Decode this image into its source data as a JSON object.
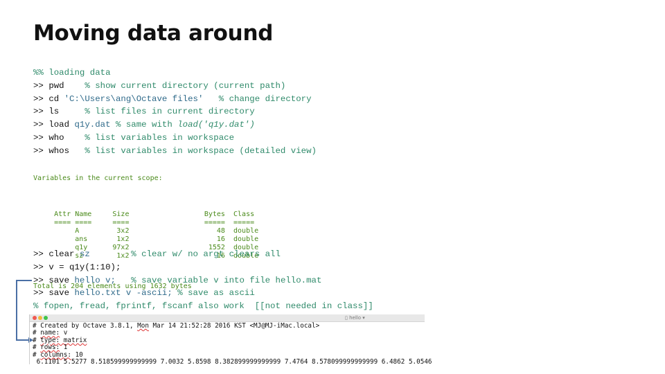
{
  "title": "Moving data around",
  "code_block_1": [
    {
      "prompt": "%%",
      "cmd": "",
      "arg": "",
      "comment": " loading data",
      "prompt_is_comment": true
    },
    {
      "prompt": ">> ",
      "cmd": "pwd",
      "arg": "",
      "comment": "    % show current directory (current path)"
    },
    {
      "prompt": ">> ",
      "cmd": "cd ",
      "arg": "'C:\\Users\\ang\\Octave files'",
      "comment": "   % change directory"
    },
    {
      "prompt": ">> ",
      "cmd": "ls",
      "arg": "",
      "comment": "     % list files in current directory"
    },
    {
      "prompt": ">> ",
      "cmd": "load ",
      "arg": "q1y.dat",
      "comment": " % same with ",
      "italic": "load('q1y.dat')"
    },
    {
      "prompt": ">> ",
      "cmd": "who",
      "arg": "",
      "comment": "    % list variables in workspace"
    },
    {
      "prompt": ">> ",
      "cmd": "whos",
      "arg": "",
      "comment": "   % list variables in workspace (detailed view)"
    }
  ],
  "whos_output": {
    "scope_label": "Variables in the current scope:",
    "headers": {
      "attr": "Attr",
      "name": "Name",
      "size": "Size",
      "bytes": "Bytes",
      "class": "Class"
    },
    "underline": {
      "attr": "====",
      "name": "====",
      "size": "====",
      "bytes": "=====",
      "class": "====="
    },
    "rows": [
      {
        "attr": "",
        "name": "A",
        "size": "3x2",
        "bytes": "48",
        "class": "double"
      },
      {
        "attr": "",
        "name": "ans",
        "size": "1x2",
        "bytes": "16",
        "class": "double"
      },
      {
        "attr": "",
        "name": "q1y",
        "size": "97x2",
        "bytes": "1552",
        "class": "double"
      },
      {
        "attr": "",
        "name": "sz",
        "size": "1x2",
        "bytes": "16",
        "class": "double"
      }
    ],
    "total": "Total is 204 elements using 1632 bytes"
  },
  "code_block_2": [
    {
      "prompt": ">> ",
      "cmd": "clear ",
      "arg": "sz",
      "comment": "        % clear w/ no argt clears all"
    },
    {
      "prompt": ">> ",
      "cmd": "v = q1y(1:10);",
      "arg": "",
      "comment": ""
    },
    {
      "prompt": ">> ",
      "cmd": "save ",
      "arg": "hello v;",
      "comment": "   % save variable v into file hello.mat"
    },
    {
      "prompt": ">> ",
      "cmd": "save ",
      "arg": "hello.txt v -ascii;",
      "comment": " % save as ascii"
    },
    {
      "prompt": "",
      "cmd": "",
      "arg": "",
      "comment": "% fopen, fread, fprintf, fscanf also work  [[not needed in class]]"
    }
  ],
  "editor": {
    "filename": "hello",
    "lines": [
      {
        "prefix": "# ",
        "key": "Created by Octave 3.8.1, ",
        "squiggle": "Mon",
        "rest": " Mar 14 21:52:28 2016 KST <MJ@MJ-iMac.local>"
      },
      {
        "prefix": "# ",
        "key": "",
        "squiggle": "name:",
        "rest": " v"
      },
      {
        "prefix": "# ",
        "key": "",
        "squiggle": "type: matrix",
        "rest": ""
      },
      {
        "prefix": "# ",
        "key": "",
        "squiggle": "rows:",
        "rest": " 1"
      },
      {
        "prefix": "# ",
        "key": "",
        "squiggle": "columns:",
        "rest": " 10"
      },
      {
        "prefix": " ",
        "key": "6.1101 5.5277 8.518599999999999 7.0032 5.8598 8.382899999999999 7.4764 8.578099999999999 6.4862 5.0546",
        "squiggle": "",
        "rest": ""
      }
    ]
  },
  "colors": {
    "comment": "#2f8a6a",
    "string": "#2f6a8a",
    "output": "#4a8a1a",
    "arrow": "#4a6fa5"
  }
}
